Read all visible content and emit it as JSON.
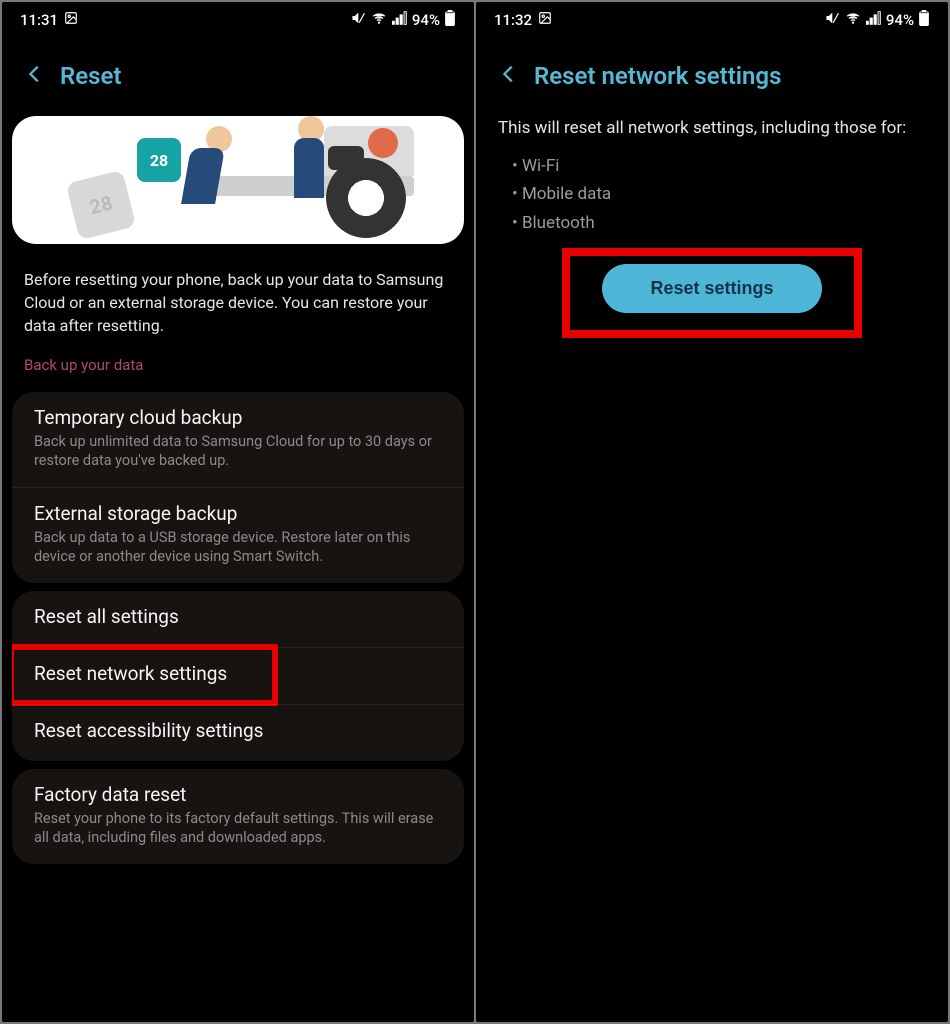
{
  "left": {
    "status": {
      "time": "11:31",
      "battery": "94%"
    },
    "appbar": {
      "title": "Reset"
    },
    "hero": {
      "calA": "28",
      "calB": "28"
    },
    "intro": "Before resetting your phone, back up your data to Samsung Cloud or an external storage device. You can restore your data after resetting.",
    "section_label": "Back up your data",
    "backup": {
      "cloud": {
        "title": "Temporary cloud backup",
        "sub": "Back up unlimited data to Samsung Cloud for up to 30 days or restore data you've backed up."
      },
      "external": {
        "title": "External storage backup",
        "sub": "Back up data to a USB storage device. Restore later on this device or another device using Smart Switch."
      }
    },
    "reset": {
      "all": "Reset all settings",
      "network": "Reset network settings",
      "accessibility": "Reset accessibility settings"
    },
    "factory": {
      "title": "Factory data reset",
      "sub": "Reset your phone to its factory default settings. This will erase all data, including files and downloaded apps."
    }
  },
  "right": {
    "status": {
      "time": "11:32",
      "battery": "94%"
    },
    "appbar": {
      "title": "Reset network settings"
    },
    "desc": "This will reset all network settings, including those for:",
    "bullets": {
      "b0": "Wi-Fi",
      "b1": "Mobile data",
      "b2": "Bluetooth"
    },
    "button": "Reset settings"
  }
}
